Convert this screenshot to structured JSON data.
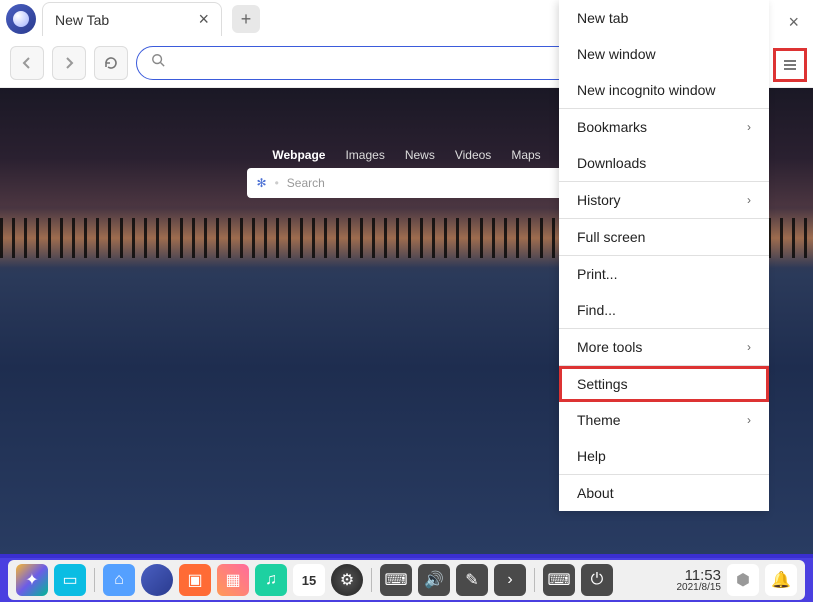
{
  "tab": {
    "title": "New Tab"
  },
  "url_bar": {
    "placeholder": ""
  },
  "content": {
    "nav": [
      "Webpage",
      "Images",
      "News",
      "Videos",
      "Maps"
    ],
    "active_nav": "Webpage",
    "search_placeholder": "Search"
  },
  "menu": {
    "groups": [
      [
        {
          "label": "New tab",
          "submenu": false
        },
        {
          "label": "New window",
          "submenu": false
        },
        {
          "label": "New incognito window",
          "submenu": false
        }
      ],
      [
        {
          "label": "Bookmarks",
          "submenu": true
        },
        {
          "label": "Downloads",
          "submenu": false
        }
      ],
      [
        {
          "label": "History",
          "submenu": true
        }
      ],
      [
        {
          "label": "Full screen",
          "submenu": false
        }
      ],
      [
        {
          "label": "Print...",
          "submenu": false
        },
        {
          "label": "Find...",
          "submenu": false
        }
      ],
      [
        {
          "label": "More tools",
          "submenu": true
        }
      ],
      [
        {
          "label": "Settings",
          "submenu": false,
          "highlighted": true
        },
        {
          "label": "Theme",
          "submenu": true
        },
        {
          "label": "Help",
          "submenu": false
        }
      ],
      [
        {
          "label": "About",
          "submenu": false
        }
      ]
    ]
  },
  "taskbar": {
    "date_day": "15",
    "time": "11:53",
    "date": "2021/8/15"
  }
}
